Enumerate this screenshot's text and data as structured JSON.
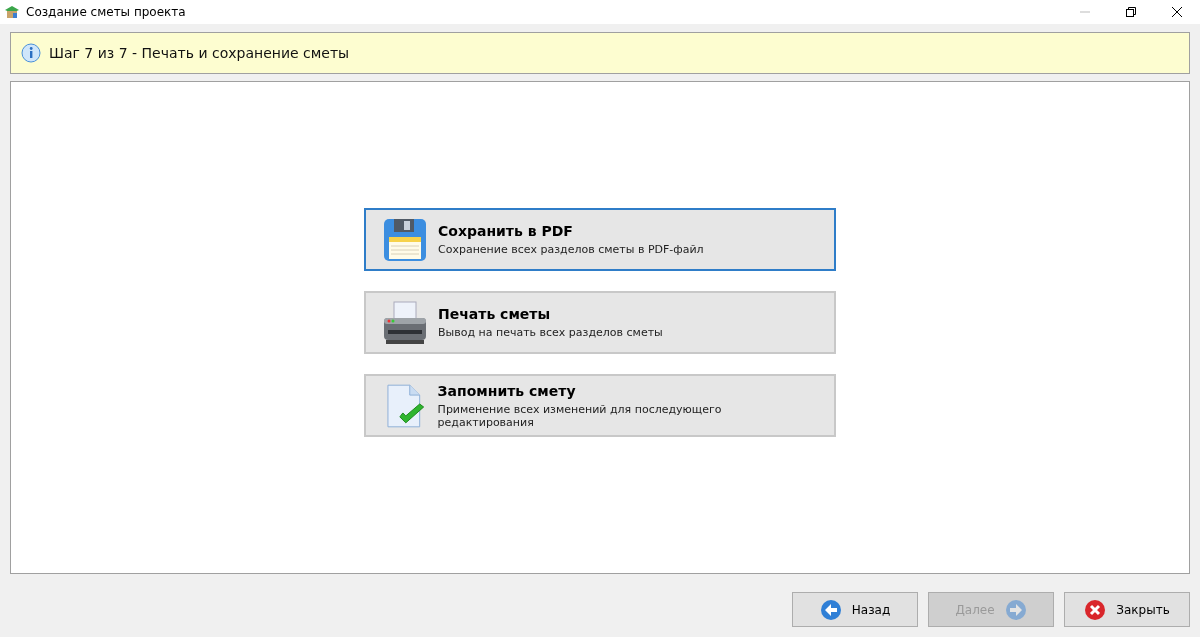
{
  "window": {
    "title": "Создание сметы проекта"
  },
  "banner": {
    "text": "Шаг 7 из 7 - Печать и сохранение сметы"
  },
  "options": [
    {
      "kind": "save",
      "title": "Сохранить в PDF",
      "description": "Сохранение всех разделов сметы в PDF-файл",
      "selected": true
    },
    {
      "kind": "print",
      "title": "Печать сметы",
      "description": "Вывод на печать всех разделов сметы",
      "selected": false
    },
    {
      "kind": "remember",
      "title": "Запомнить смету",
      "description": "Применение всех изменений для последующего редактирования",
      "selected": false
    }
  ],
  "buttons": [
    {
      "kind": "back",
      "label": "Назад",
      "disabled": false
    },
    {
      "kind": "next",
      "label": "Далее",
      "disabled": true
    },
    {
      "kind": "close",
      "label": "Закрыть",
      "disabled": false
    }
  ]
}
